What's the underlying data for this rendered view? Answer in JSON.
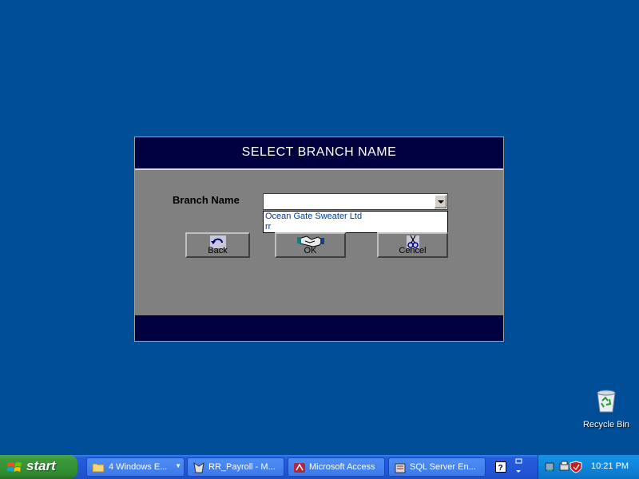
{
  "dialog": {
    "title": "SELECT BRANCH NAME",
    "branch_label": "Branch Name",
    "combo_value": "",
    "dropdown_options": [
      "Ocean Gate Sweater Ltd",
      "rr"
    ],
    "buttons": {
      "back": "Back",
      "ok": "OK",
      "cancel": "Cencel"
    }
  },
  "desktop": {
    "recycle_bin_label": "Recycle Bin"
  },
  "taskbar": {
    "start_label": "start",
    "tasks": [
      {
        "label": "4 Windows E...",
        "icon": "folder-icon"
      },
      {
        "label": "RR_Payroll - M...",
        "icon": "payroll-app-icon"
      },
      {
        "label": "Microsoft Access",
        "icon": "access-icon"
      },
      {
        "label": "SQL Server En...",
        "icon": "sql-server-icon"
      }
    ],
    "clock": "10:21 PM"
  },
  "colors": {
    "desktop_bg": "#004E98",
    "dialog_bg": "#808080",
    "dialog_header": "#000040",
    "taskbar_blue": "#245EDC",
    "start_green": "#3C9A3C"
  }
}
